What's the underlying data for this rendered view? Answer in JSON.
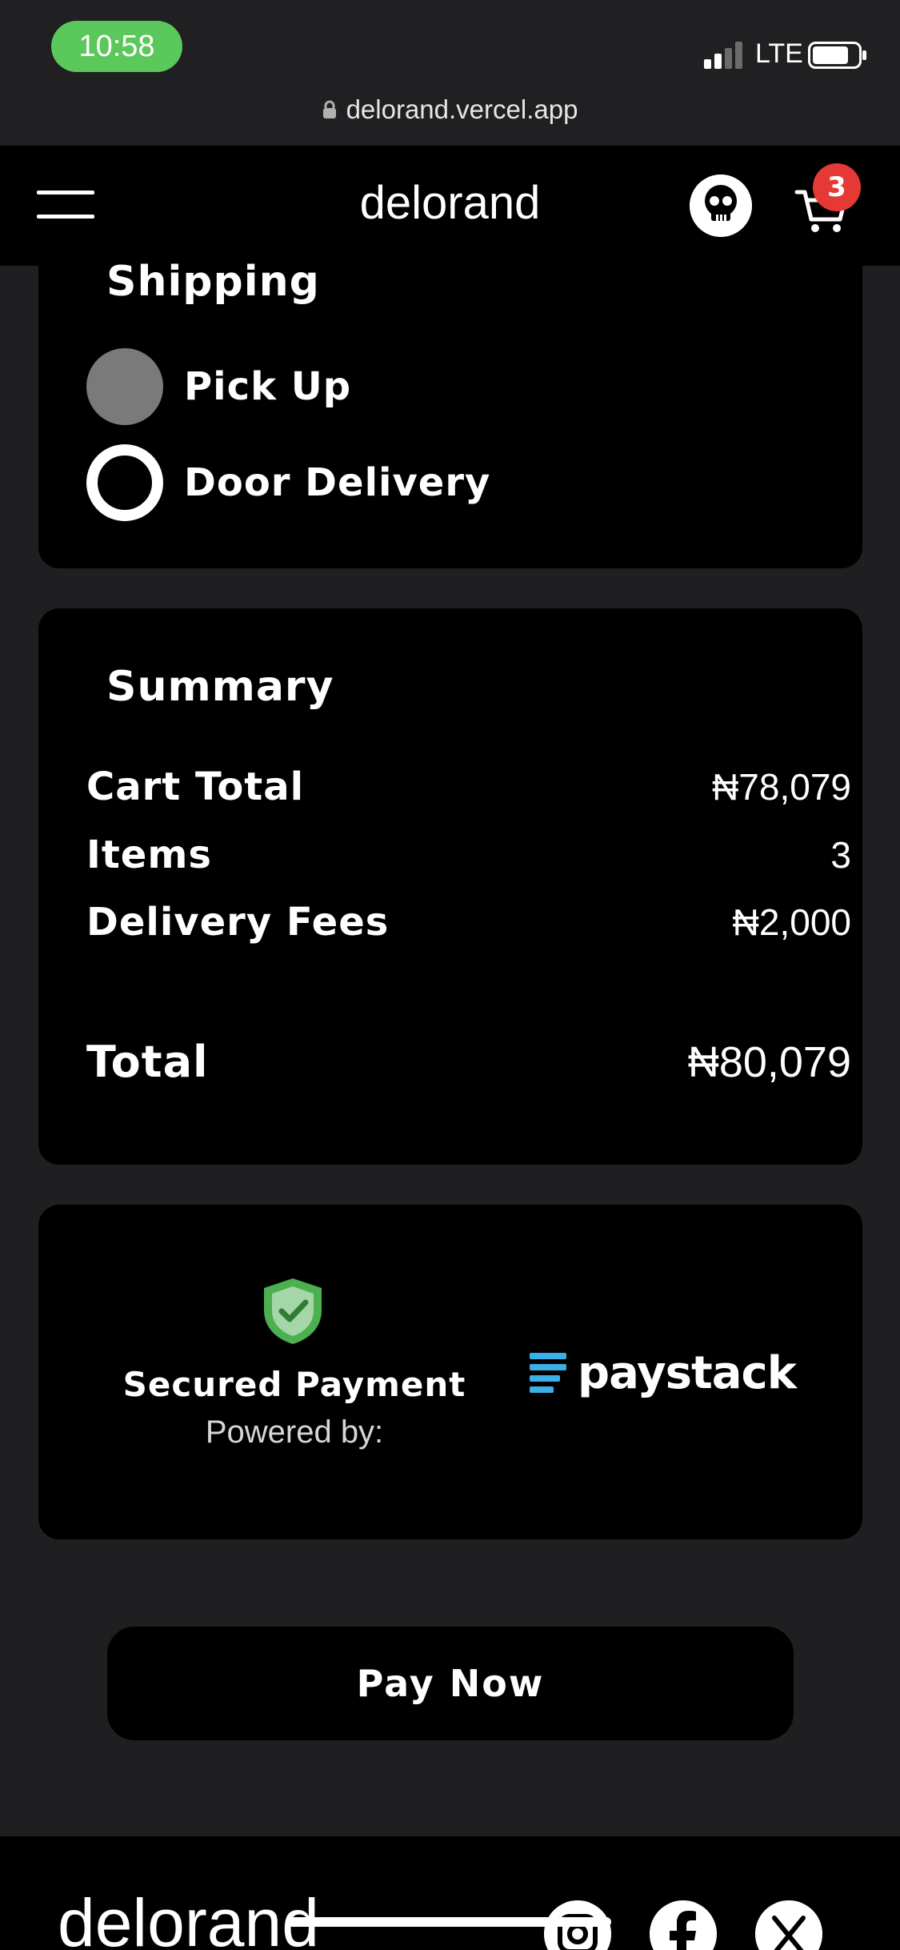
{
  "status_bar": {
    "time": "10:58",
    "network": "LTE",
    "url": "delorand.vercel.app"
  },
  "nav": {
    "brand": "delorand",
    "cart_count": "3"
  },
  "shipping": {
    "title": "Shipping",
    "options": [
      {
        "label": "Pick Up",
        "selected": true
      },
      {
        "label": "Door Delivery",
        "selected": false
      }
    ]
  },
  "summary": {
    "title": "Summary",
    "rows": [
      {
        "label": "Cart Total",
        "value": "₦78,079"
      },
      {
        "label": "Items",
        "value": "3"
      },
      {
        "label": "Delivery Fees",
        "value": "₦2,000"
      }
    ],
    "total": {
      "label": "Total",
      "value": "₦80,079"
    }
  },
  "payment": {
    "secured_label": "Secured Payment",
    "powered_label": "Powered by:",
    "provider": "paystack",
    "shield_color": "#4caf50",
    "provider_color": "#3bb0e8"
  },
  "pay_button": {
    "label": "Pay Now"
  },
  "footer": {
    "brand": "delorand",
    "social": [
      "instagram-icon",
      "facebook-icon",
      "x-icon"
    ]
  }
}
